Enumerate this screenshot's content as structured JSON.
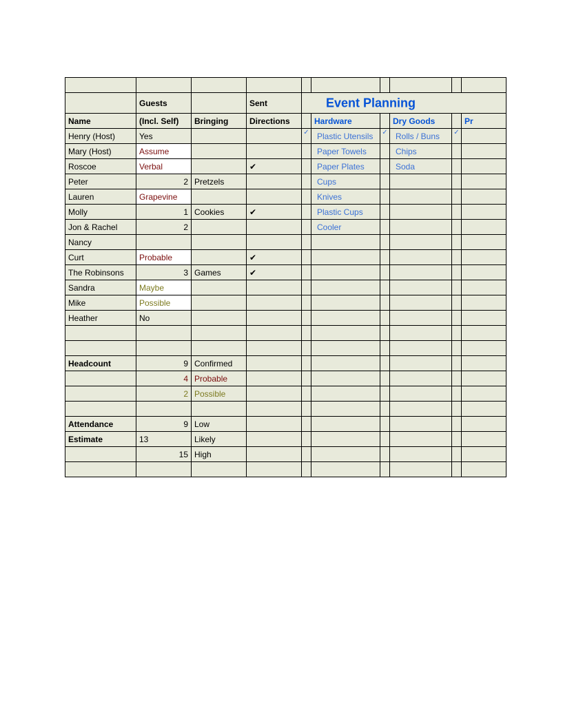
{
  "title": "Event Planning",
  "headers": {
    "guests": "Guests",
    "sent": "Sent",
    "name": "Name",
    "incl_self": "(Incl. Self)",
    "bringing": "Bringing",
    "directions": "Directions",
    "hardware": "Hardware",
    "dry_goods": "Dry Goods",
    "prep": "Pr"
  },
  "rows": [
    {
      "name": "Henry (Host)",
      "guests": "Yes",
      "bringing": "",
      "directions": "",
      "hw_ck": "✓",
      "hw": "Plastic Utensils",
      "dg_ck": "✓",
      "dg": "Rolls / Buns",
      "pr_ck": "✓"
    },
    {
      "name": "Mary (Host)",
      "guests": "Assume",
      "guests_white": true,
      "guests_red": true,
      "bringing": "",
      "directions": "",
      "hw_ck": "",
      "hw": "Paper Towels",
      "dg_ck": "",
      "dg": "Chips",
      "pr_ck": ""
    },
    {
      "name": "Roscoe",
      "guests": "Verbal",
      "guests_white": true,
      "guests_red": true,
      "bringing": "",
      "directions": "✔",
      "hw_ck": "",
      "hw": "Paper Plates",
      "dg_ck": "",
      "dg": "Soda",
      "pr_ck": ""
    },
    {
      "name": "Peter",
      "guests": "2",
      "guests_num": true,
      "bringing": "Pretzels",
      "directions": "",
      "hw_ck": "",
      "hw": "Cups",
      "dg_ck": "",
      "dg": "",
      "pr_ck": ""
    },
    {
      "name": "Lauren",
      "guests": "Grapevine",
      "guests_white": true,
      "guests_red": true,
      "bringing": "",
      "directions": "",
      "hw_ck": "",
      "hw": "Knives",
      "dg_ck": "",
      "dg": "",
      "pr_ck": ""
    },
    {
      "name": "Molly",
      "guests": "1",
      "guests_num": true,
      "bringing": "Cookies",
      "directions": "✔",
      "hw_ck": "",
      "hw": "Plastic Cups",
      "dg_ck": "",
      "dg": "",
      "pr_ck": ""
    },
    {
      "name": "Jon & Rachel",
      "guests": "2",
      "guests_num": true,
      "bringing": "",
      "directions": "",
      "hw_ck": "",
      "hw": "Cooler",
      "dg_ck": "",
      "dg": "",
      "pr_ck": ""
    },
    {
      "name": "Nancy",
      "guests": "",
      "bringing": "",
      "directions": "",
      "hw_ck": "",
      "hw": "",
      "dg_ck": "",
      "dg": "",
      "pr_ck": ""
    },
    {
      "name": "Curt",
      "guests": "Probable",
      "guests_white": true,
      "guests_red": true,
      "bringing": "",
      "directions": "✔",
      "hw_ck": "",
      "hw": "",
      "dg_ck": "",
      "dg": "",
      "pr_ck": ""
    },
    {
      "name": "The Robinsons",
      "guests": "3",
      "guests_num": true,
      "bringing": "Games",
      "directions": "✔",
      "hw_ck": "",
      "hw": "",
      "dg_ck": "",
      "dg": "",
      "pr_ck": ""
    },
    {
      "name": "Sandra",
      "guests": "Maybe",
      "guests_white": true,
      "guests_olive": true,
      "bringing": "",
      "directions": "",
      "hw_ck": "",
      "hw": "",
      "dg_ck": "",
      "dg": "",
      "pr_ck": ""
    },
    {
      "name": "Mike",
      "guests": "Possible",
      "guests_white": true,
      "guests_olive": true,
      "bringing": "",
      "directions": "",
      "hw_ck": "",
      "hw": "",
      "dg_ck": "",
      "dg": "",
      "pr_ck": ""
    },
    {
      "name": "Heather",
      "guests": "No",
      "bringing": "",
      "directions": "",
      "hw_ck": "",
      "hw": "",
      "dg_ck": "",
      "dg": "",
      "pr_ck": ""
    }
  ],
  "summary": {
    "headcount_label": "Headcount",
    "headcount_n": "9",
    "headcount_t": "Confirmed",
    "probable_n": "4",
    "probable_t": "Probable",
    "possible_n": "2",
    "possible_t": "Possible",
    "attendance_label": "Attendance",
    "attendance_n": "9",
    "attendance_t": "Low",
    "estimate_label": "Estimate",
    "estimate_g": "13",
    "estimate_t": "Likely",
    "high_n": "15",
    "high_t": "High"
  }
}
